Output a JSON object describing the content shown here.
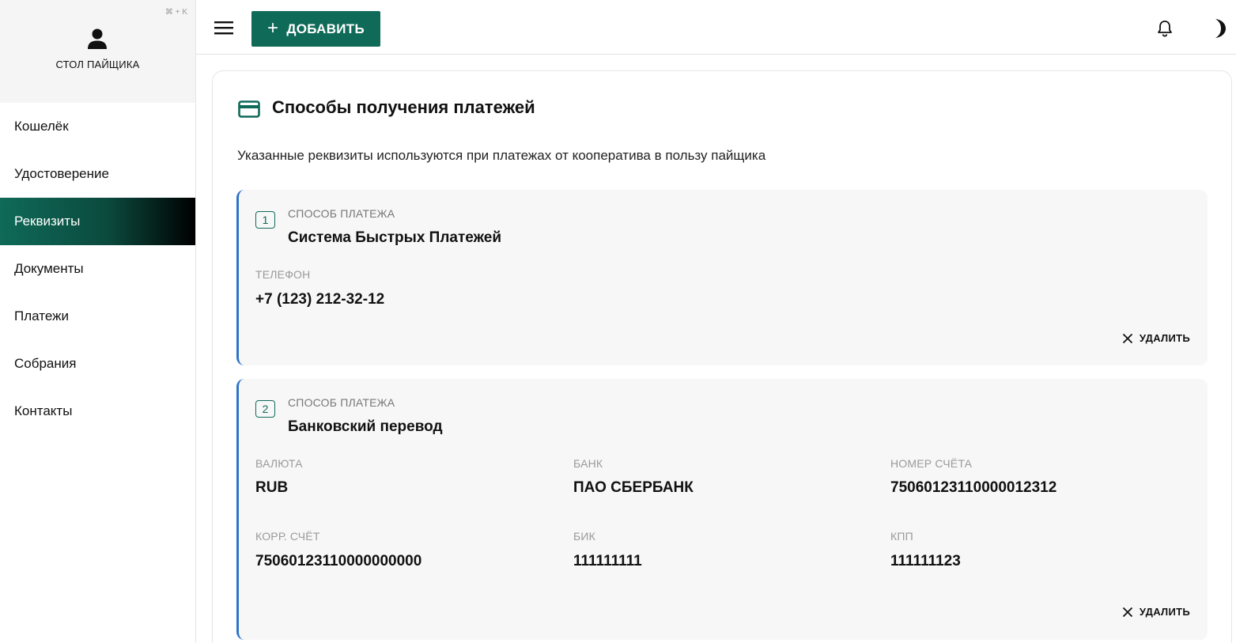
{
  "sidebar": {
    "shortcut": "⌘ + K",
    "profile_name": "СТОЛ ПАЙЩИКА",
    "items": [
      {
        "label": "Кошелёк"
      },
      {
        "label": "Удостоверение"
      },
      {
        "label": "Реквизиты",
        "active": true
      },
      {
        "label": "Документы"
      },
      {
        "label": "Платежи"
      },
      {
        "label": "Собрания"
      },
      {
        "label": "Контакты"
      }
    ]
  },
  "topbar": {
    "add_label": "ДОБАВИТЬ",
    "icons": [
      "menu-icon",
      "bell-icon",
      "moon-icon"
    ]
  },
  "main": {
    "title": "Способы получения платежей",
    "description": "Указанные реквизиты используются при платежах от кооператива в пользу пайщика",
    "methods": [
      {
        "number": "1",
        "method_label": "СПОСОБ ПЛАТЕЖА",
        "method_name": "Система Быстрых Платежей",
        "fields": [
          {
            "label": "ТЕЛЕФОН",
            "value": "+7 (123) 212-32-12"
          }
        ],
        "delete_label": "УДАЛИТЬ"
      },
      {
        "number": "2",
        "method_label": "СПОСОБ ПЛАТЕЖА",
        "method_name": "Банковский перевод",
        "fields": [
          {
            "label": "ВАЛЮТА",
            "value": "RUB"
          },
          {
            "label": "БАНК",
            "value": "ПАО СБЕРБАНК"
          },
          {
            "label": "НОМЕР СЧЁТА",
            "value": "75060123110000012312"
          },
          {
            "label": "КОРР. СЧЁТ",
            "value": "75060123110000000000"
          },
          {
            "label": "БИК",
            "value": "111111111"
          },
          {
            "label": "КПП",
            "value": "111111123"
          }
        ],
        "delete_label": "УДАЛИТЬ"
      }
    ]
  },
  "colors": {
    "accent": "#0f6a58",
    "method_border": "#2f74c9",
    "card_bg": "#f7f7f7"
  }
}
